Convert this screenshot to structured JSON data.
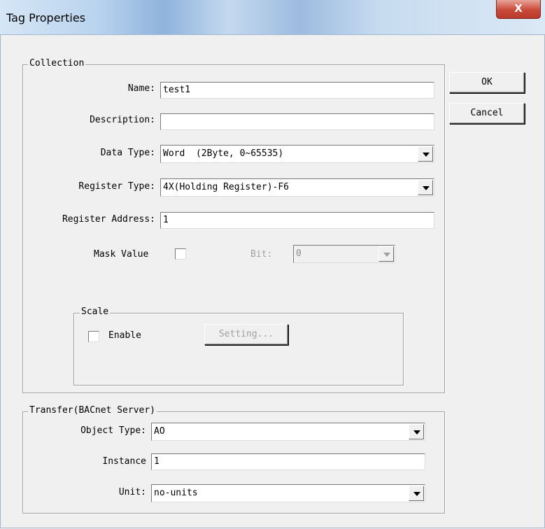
{
  "window": {
    "title": "Tag Properties",
    "close_glyph": "X"
  },
  "buttons": {
    "ok": "OK",
    "cancel": "Cancel"
  },
  "collection": {
    "legend": "Collection",
    "name_label": "Name:",
    "name_value": "test1",
    "description_label": "Description:",
    "description_value": "",
    "data_type_label": "Data Type:",
    "data_type_value": "Word  (2Byte, 0~65535)",
    "register_type_label": "Register Type:",
    "register_type_value": "4X(Holding Register)-F6",
    "register_address_label": "Register Address:",
    "register_address_value": "1",
    "mask_value_label": "Mask Value",
    "mask_value_checked": false,
    "bit_label": "Bit:",
    "bit_value": "0"
  },
  "scale": {
    "legend": "Scale",
    "enable_label": "Enable",
    "enable_checked": false,
    "setting_button": "Setting..."
  },
  "transfer": {
    "legend": "Transfer(BACnet Server)",
    "object_type_label": "Object Type:",
    "object_type_value": "AO",
    "instance_label": "Instance",
    "instance_value": "1",
    "unit_label": "Unit:",
    "unit_value": "no-units"
  }
}
